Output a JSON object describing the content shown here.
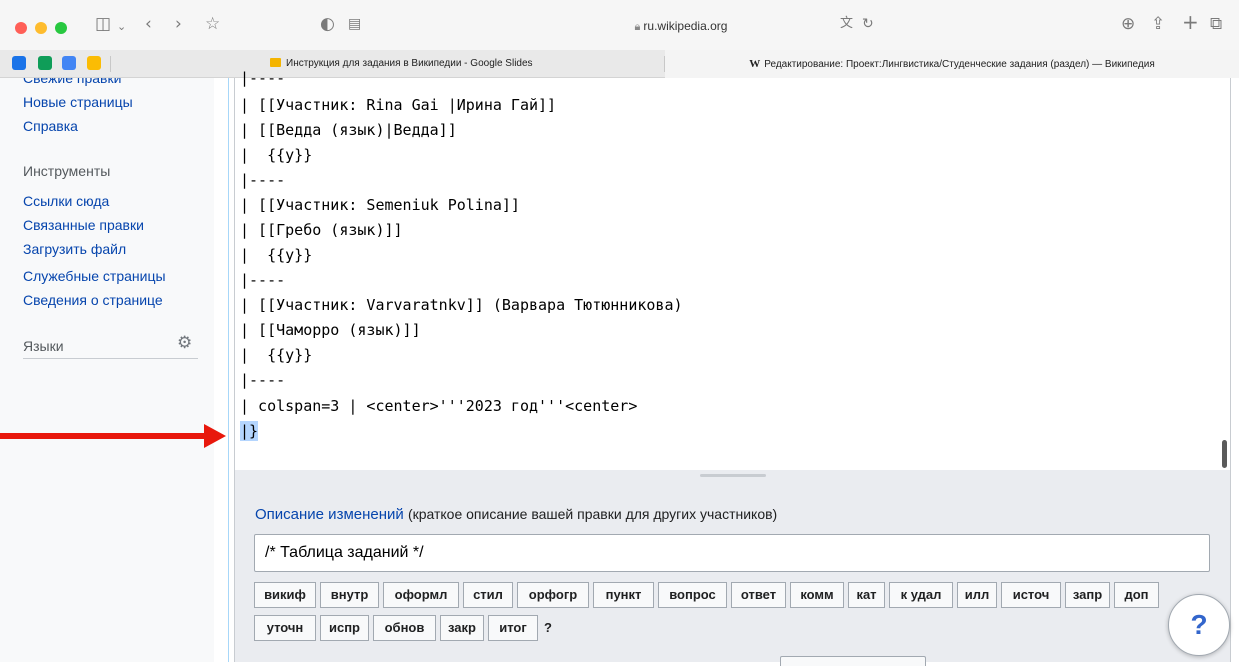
{
  "browser": {
    "url": "ru.wikipedia.org",
    "tabs": [
      {
        "label": "Инструкция для задания в Википедии - Google Slides",
        "active": false
      },
      {
        "label": "Редактирование: Проект:Лингвистика/Студенческие задания (раздел) — Википедия",
        "active": true
      }
    ]
  },
  "sidebar": {
    "cutoff_item": "Свежие правки",
    "nav_items": [
      "Новые страницы",
      "Справка"
    ],
    "tools_heading": "Инструменты",
    "tools_items": [
      "Ссылки сюда",
      "Связанные правки",
      "Загрузить файл",
      "Служебные страницы",
      "Сведения о странице"
    ],
    "languages_heading": "Языки"
  },
  "editor": {
    "lines": [
      "|----",
      "| [[Участник: Rina Gai |Ирина Гай]]",
      "| [[Ведда (язык)|Ведда]]",
      "|  {{y}}",
      "|----",
      "| [[Участник: Semeniuk Polina]]",
      "| [[Гребо (язык)]]",
      "|  {{y}}",
      "|----",
      "| [[Участник: Varvaratnkv]] (Варвара Тютюнникова)",
      "| [[Чаморро (язык)]]",
      "|  {{y}}",
      "|----",
      "| colspan=3 | <center>'''2023 год'''<center>",
      "|}"
    ]
  },
  "summary": {
    "label_link": "Описание изменений",
    "label_hint": "(краткое описание вашей правки для других участников)",
    "value": "/* Таблица заданий */",
    "chips_row1": [
      "викиф",
      "внутр",
      "оформл",
      "стил",
      "орфогр",
      "пункт",
      "вопрос",
      "ответ",
      "комм",
      "кат",
      "к удал",
      "илл",
      "источ",
      "запр",
      "доп"
    ],
    "chips_row2": [
      "уточн",
      "испр",
      "обнов",
      "закр",
      "итог"
    ],
    "question": "?"
  },
  "help_button": "?",
  "colors": {
    "link": "#0645ad",
    "arrow": "#e8180c",
    "selection": "#b4d5fe"
  }
}
